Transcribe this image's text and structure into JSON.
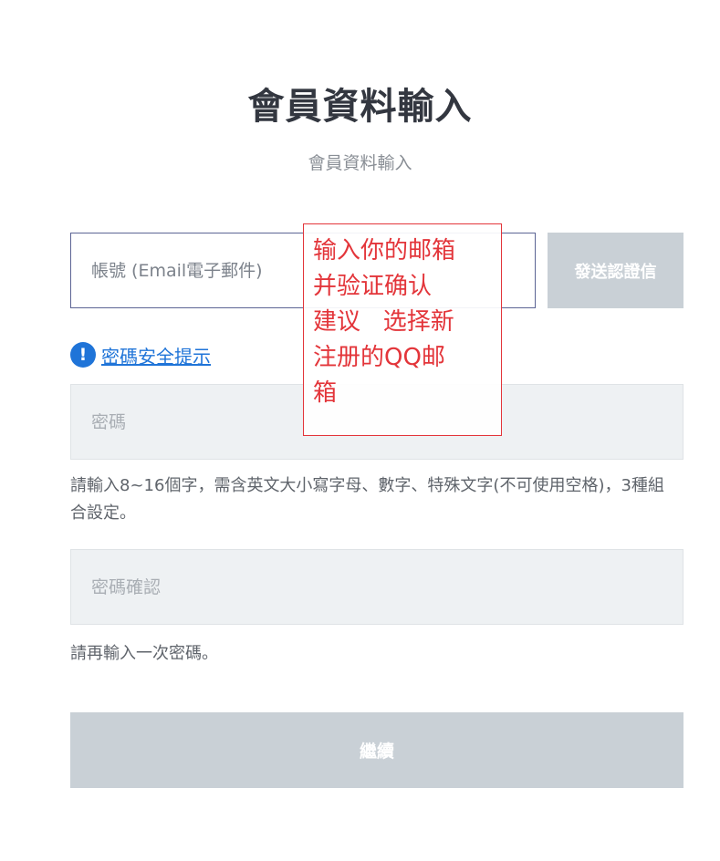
{
  "header": {
    "title": "會員資料輸入",
    "subtitle": "會員資料輸入"
  },
  "form": {
    "email_placeholder": "帳號 (Email電子郵件)",
    "send_verification_label": "發送認證信",
    "security_tip_label": "密碼安全提示",
    "password_placeholder": "密碼",
    "password_hint": "請輸入8~16個字，需含英文大小寫字母、數字、特殊文字(不可使用空格)，3種組合設定。",
    "password_confirm_placeholder": "密碼確認",
    "password_confirm_hint": "請再輸入一次密碼。",
    "continue_label": "繼續"
  },
  "annotation": {
    "text": "输入你的邮箱\n并验证确认\n建议   选择新\n注册的QQ邮\n箱"
  },
  "icons": {
    "info": "info-icon"
  },
  "colors": {
    "accent_link": "#1f74d8",
    "disabled_button": "#c9d0d6",
    "annotation_red": "#e3353a"
  }
}
